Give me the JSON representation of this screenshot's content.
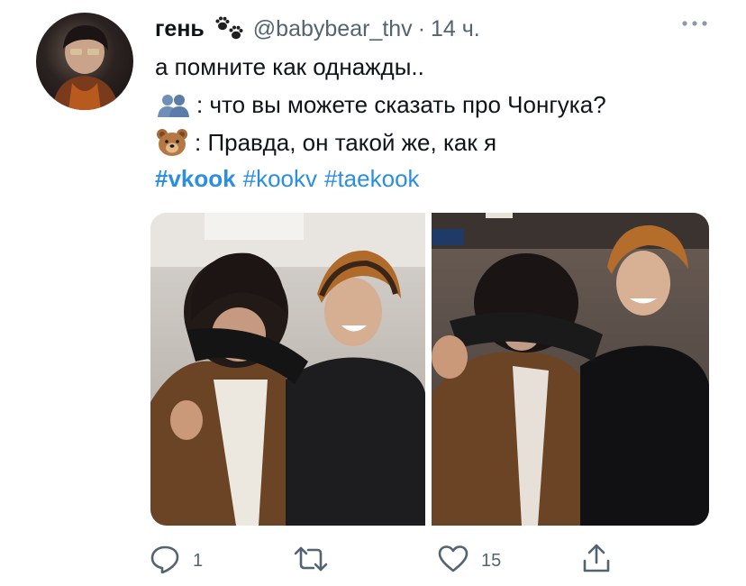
{
  "tweet": {
    "author_name": "гень",
    "author_handle": "@babybear_thv",
    "separator": "·",
    "time": "14 ч.",
    "lines": [
      "а помните как однажды..",
      ": что вы можете сказать про Чонгука?",
      ": Правда, он такой же, как я"
    ],
    "hashtags": [
      "#vkook",
      "#kookv",
      "#taekook"
    ]
  },
  "icons": {
    "author_badge": "paw-prints-icon",
    "line2_emoji": "two-people-silhouette-icon",
    "line3_emoji": "bear-face-icon",
    "more": "more-dots-icon",
    "reply": "reply-bubble-icon",
    "retweet": "retweet-arrows-icon",
    "like": "heart-icon",
    "share": "share-upload-icon"
  },
  "actions": {
    "reply_count": "1",
    "retweet_count": "",
    "like_count": "15"
  },
  "colors": {
    "link": "#2b8ee0",
    "secondary_text": "#536471",
    "primary_text": "#0f1419"
  }
}
